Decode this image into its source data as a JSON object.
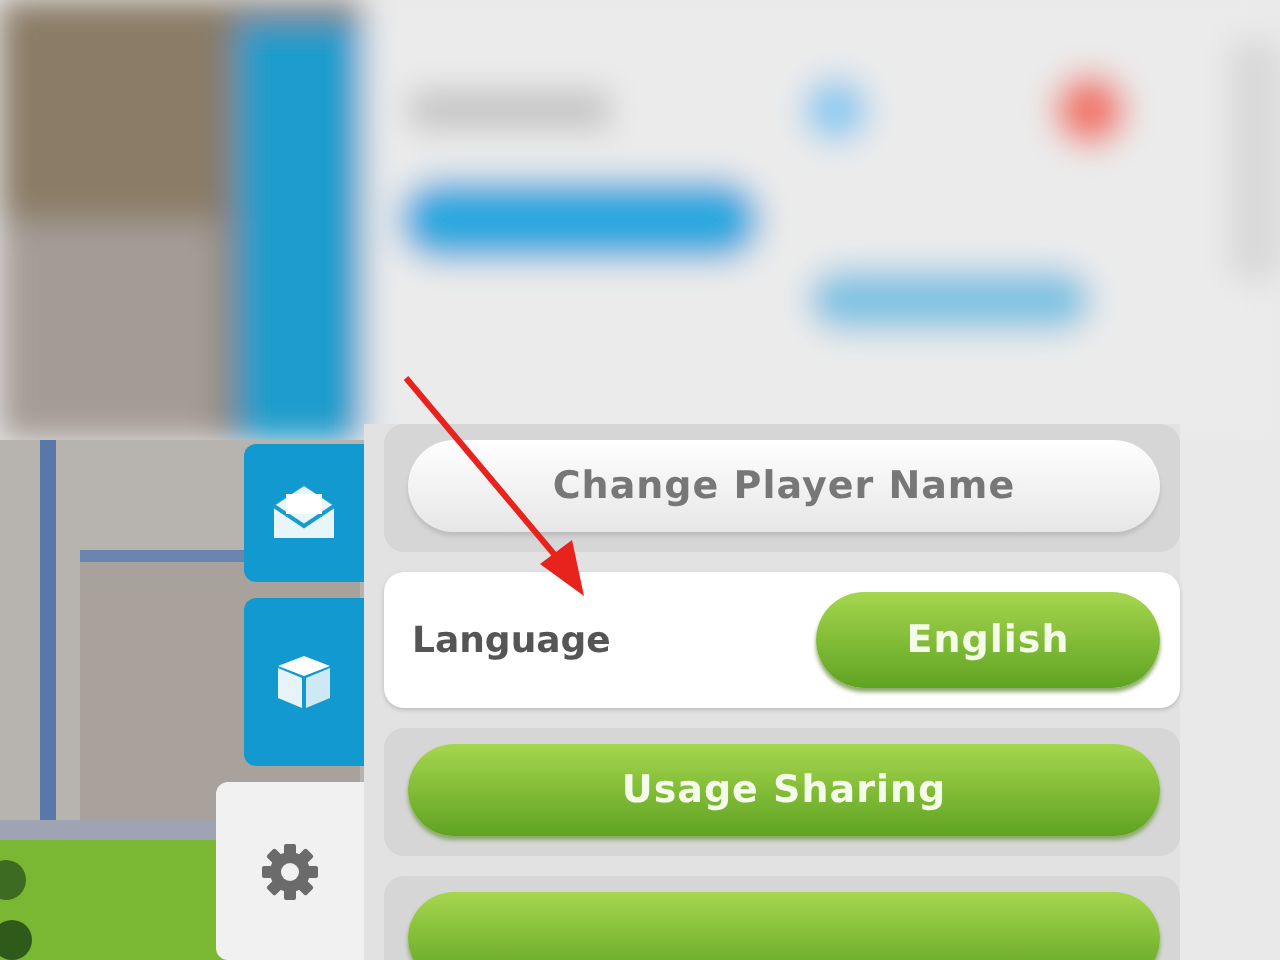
{
  "side_tabs": [
    {
      "kind": "mail",
      "selected": false
    },
    {
      "kind": "box",
      "selected": false
    },
    {
      "kind": "gear",
      "selected": true
    }
  ],
  "settings": [
    {
      "kind": "white-button",
      "label": "Change Player Name"
    },
    {
      "kind": "option",
      "label": "Language",
      "value": "English"
    },
    {
      "kind": "green-button",
      "label": "Usage Sharing"
    },
    {
      "kind": "green-button"
    }
  ]
}
